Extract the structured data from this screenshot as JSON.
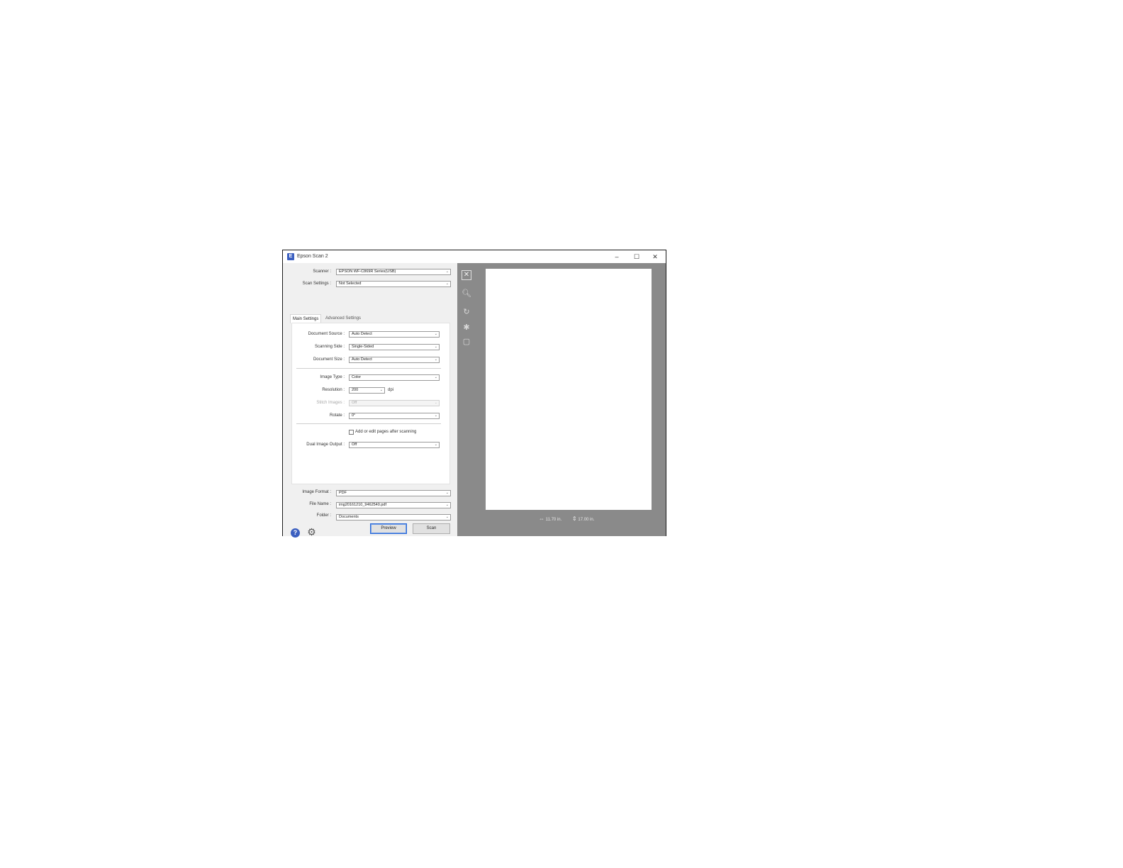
{
  "window": {
    "title": "Epson Scan 2",
    "app_icon_glyph": "E",
    "minimize_glyph": "–",
    "maximize_glyph": "☐",
    "close_glyph": "✕"
  },
  "top_fields": {
    "scanner_label": "Scanner :",
    "scanner_value": "EPSON WF-C869R Series(USB)",
    "scan_settings_label": "Scan Settings :",
    "scan_settings_value": "Not Selected"
  },
  "tabs": {
    "main": "Main Settings",
    "advanced": "Advanced Settings"
  },
  "main_settings": {
    "document_source_label": "Document Source :",
    "document_source_value": "Auto Detect",
    "scanning_side_label": "Scanning Side :",
    "scanning_side_value": "Single-Sided",
    "document_size_label": "Document Size :",
    "document_size_value": "Auto Detect",
    "image_type_label": "Image Type :",
    "image_type_value": "Color",
    "resolution_label": "Resolution :",
    "resolution_value": "200",
    "resolution_unit": "dpi",
    "stitch_images_label": "Stitch Images :",
    "stitch_images_value": "Off",
    "rotate_label": "Rotate :",
    "rotate_value": "0°",
    "add_edit_label": "Add or edit pages after scanning",
    "dual_image_label": "Dual Image Output :",
    "dual_image_value": "Off"
  },
  "output": {
    "image_format_label": "Image Format :",
    "image_format_value": "PDF",
    "file_name_label": "File Name :",
    "file_name_value": "img20161210_9462540.pdf",
    "folder_label": "Folder :",
    "folder_value": "Documents"
  },
  "buttons": {
    "preview": "Preview",
    "scan": "Scan"
  },
  "icons": {
    "help": "?",
    "settings": "⚙",
    "close_tool": "✕",
    "zoom_tool": "🔍︎",
    "rotate_tool": "↻",
    "gear_tool": "✱",
    "crop_tool": "▢"
  },
  "preview": {
    "width_text": "11.70 in.",
    "height_text": "17.00 in."
  }
}
